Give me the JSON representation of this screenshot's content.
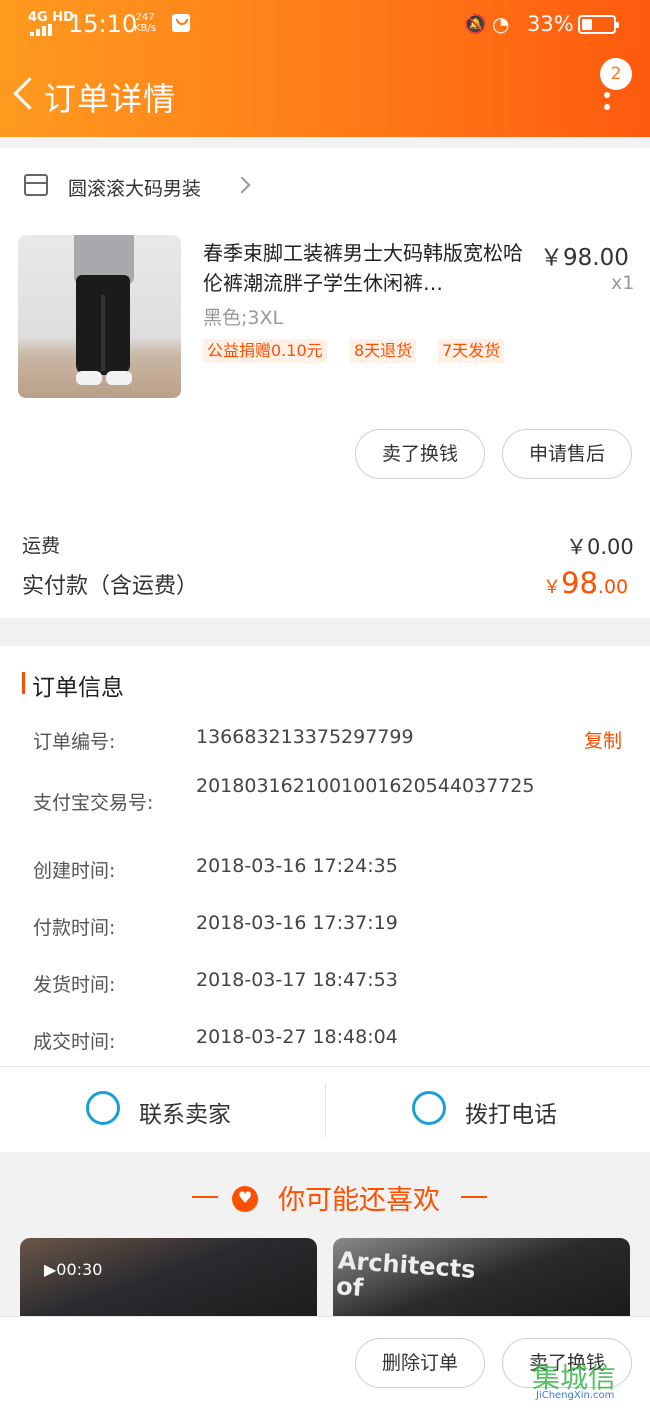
{
  "status_bar": {
    "network": "4G HD",
    "time": "15:10",
    "speed_value": "247",
    "speed_unit": "KB/s",
    "battery": "33%"
  },
  "header": {
    "title": "订单详情",
    "badge_count": "2"
  },
  "store": {
    "name": "圆滚滚大码男装"
  },
  "product": {
    "title": "春季束脚工装裤男士大码韩版宽松哈伦裤潮流胖子学生休闲裤…",
    "price": "￥98.00",
    "quantity": "x1",
    "sku": "黑色;3XL",
    "tags": [
      "公益捐赠0.10元",
      "8天退货",
      "7天发货"
    ]
  },
  "item_actions": {
    "sell_label": "卖了换钱",
    "after_sale_label": "申请售后"
  },
  "summary": {
    "shipping_label": "运费",
    "shipping_value": "￥0.00",
    "paid_label": "实付款（含运费）",
    "paid_currency": "￥",
    "paid_integer": "98",
    "paid_decimal": ".00"
  },
  "order_info": {
    "title": "订单信息",
    "copy_label": "复制",
    "rows": [
      {
        "label": "订单编号:",
        "value": "136683213375297799"
      },
      {
        "label": "支付宝交易号:",
        "value": "2018031621001001620544037725"
      },
      {
        "label": "创建时间:",
        "value": "2018-03-16 17:24:35"
      },
      {
        "label": "付款时间:",
        "value": "2018-03-16 17:37:19"
      },
      {
        "label": "发货时间:",
        "value": "2018-03-17 18:47:53"
      },
      {
        "label": "成交时间:",
        "value": "2018-03-27 18:48:04"
      }
    ]
  },
  "contact": {
    "seller_label": "联系卖家",
    "call_label": "拨打电话"
  },
  "recommend": {
    "title": "你可能还喜欢",
    "video_duration": "▶00:30",
    "card2_text": "Architects\nof"
  },
  "bottom_actions": {
    "delete_label": "删除订单",
    "sell_label": "卖了换钱"
  },
  "watermark": {
    "main": "集城信",
    "sub": "JiChengXin.com"
  },
  "colors": {
    "accent": "#ff5000",
    "header_start": "#ff9a1f",
    "header_end": "#ff5a0e",
    "link_blue": "#1aa0d8"
  }
}
